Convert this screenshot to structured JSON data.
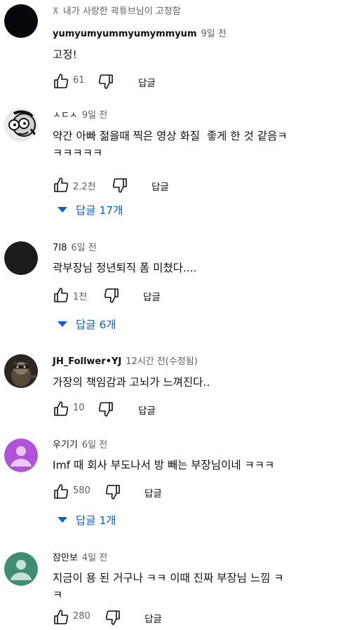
{
  "comments": [
    {
      "pinned_label": "내가 사랑한 곽튜브님이 고정함",
      "author": "yumyumyummyumymmyum",
      "time": "9일 전",
      "text": "고정!",
      "likes": "61",
      "reply_label": "답글",
      "avatar": "black-circle"
    },
    {
      "author": "ㅅㄷㅅ",
      "time": "9일 전",
      "text": "약간 아빠 젊을때 찍은 영상 화질  좋게 한 것 같음ㅋ\nㅋㅋㅋㅋㅋ",
      "likes": "2.2천",
      "reply_label": "답글",
      "replies_label": "답글 17개",
      "avatar": "cartoon-face"
    },
    {
      "author": "7I8",
      "time": "6일 전",
      "text": "곽부장님 정년퇴직 폼 미쳤다....",
      "likes": "1천",
      "reply_label": "답글",
      "replies_label": "답글 6개",
      "avatar": "black-circle"
    },
    {
      "author": "JH_Follwer•YJ",
      "time": "12시간 전(수정됨)",
      "text": "가장의 책임감과 고뇌가 느껴진다..",
      "likes": "10",
      "reply_label": "답글",
      "avatar": "raccoon-photo"
    },
    {
      "author": "우기기",
      "time": "6일 전",
      "text": "Imf 때 회사 부도나서 방 빼는 부장님이네 ㅋㅋㅋ",
      "likes": "580",
      "reply_label": "답글",
      "replies_label": "답글 1개",
      "avatar": "default-person",
      "avatar_color": "#b153d8"
    },
    {
      "author": "잠만보",
      "time": "4일 전",
      "text": "지금이 용 된 거구나 ㅋㅋ 이때 진짜 부장님 느낌 ㅋ\nㅋ",
      "likes": "280",
      "reply_label": "답글",
      "avatar": "default-person",
      "avatar_color": "#3f8d74"
    }
  ],
  "colors": {
    "link_blue": "#065fd4",
    "secondary_text": "#606060"
  }
}
